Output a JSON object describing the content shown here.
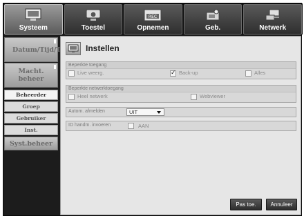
{
  "tabs": [
    {
      "label": "Systeem",
      "icon": "monitor-icon",
      "active": true
    },
    {
      "label": "Toestel",
      "icon": "camera-icon",
      "active": false
    },
    {
      "label": "Opnemen",
      "icon": "rec-icon",
      "active": false
    },
    {
      "label": "Geb.",
      "icon": "event-camera-icon",
      "active": false
    },
    {
      "label": "Netwerk",
      "icon": "network-icon",
      "active": false
    }
  ],
  "sidebar": {
    "items": [
      "Datum/Tijd/Taal",
      "Macht. beheer"
    ],
    "subitems": [
      "Beheerder",
      "Groep",
      "Gebruiker",
      "Inst."
    ],
    "last": "Syst.beheer"
  },
  "page": {
    "title": "Instellen"
  },
  "restricted_access": {
    "header": "Beperkte toegang",
    "options": [
      {
        "label": "Live weerg.",
        "checked": false
      },
      {
        "label": "Back-up",
        "checked": true
      },
      {
        "label": "Alles",
        "checked": false
      }
    ]
  },
  "network_restriction": {
    "header": "Beperkte netwerktoegang",
    "options": [
      {
        "label": "Heel netwerk",
        "checked": false
      },
      {
        "label": "Webviewer",
        "checked": false
      }
    ]
  },
  "auto_logout": {
    "label": "Autom. afmelden",
    "value": "UIT"
  },
  "manual_id": {
    "label": "ID handm. invoeren",
    "option": "AAN",
    "checked": false
  },
  "buttons": {
    "apply": "Pas toe.",
    "cancel": "Annuleer"
  },
  "colors": {
    "accent_dark": "#2c2c2c",
    "panel": "#e6e6e6",
    "frame": "#1c1c1c"
  }
}
